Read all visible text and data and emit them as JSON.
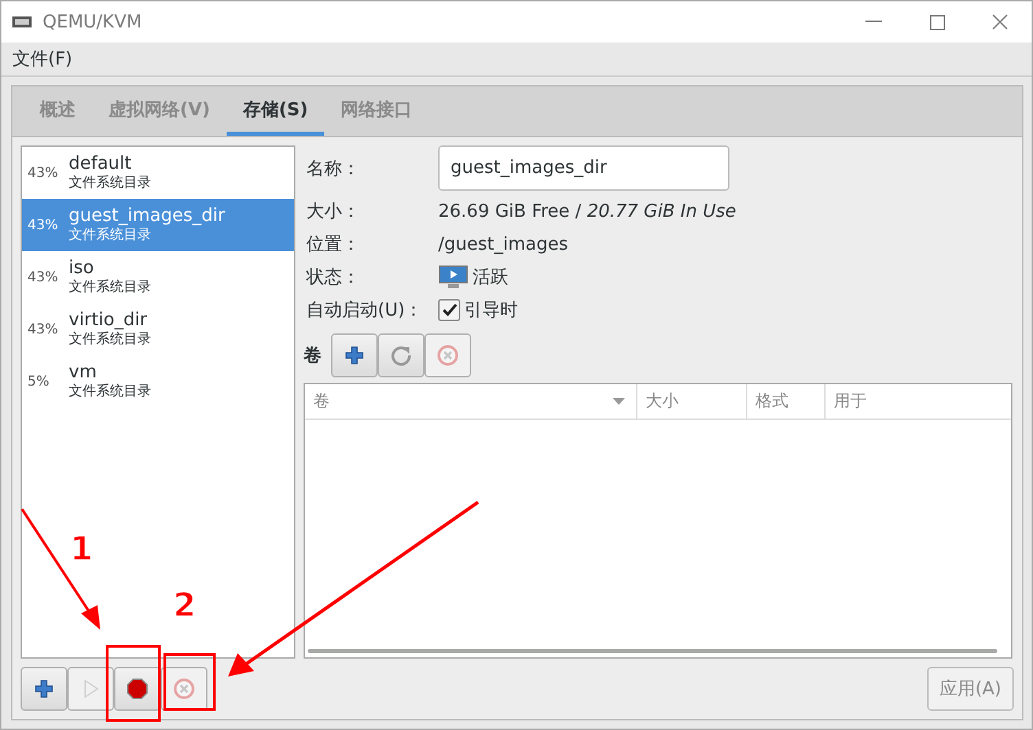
{
  "window": {
    "title": "QEMU/KVM"
  },
  "menu": [
    "文件(F)"
  ],
  "tabs": [
    {
      "label": "概述",
      "selected": false
    },
    {
      "label": "虚拟网络(V)",
      "selected": false
    },
    {
      "label": "存储(S)",
      "selected": true
    },
    {
      "label": "网络接口",
      "selected": false
    }
  ],
  "pools": [
    {
      "usage": "43%",
      "name": "default",
      "type": "文件系统目录",
      "selected": false
    },
    {
      "usage": "43%",
      "name": "guest_images_dir",
      "type": "文件系统目录",
      "selected": true
    },
    {
      "usage": "43%",
      "name": "iso",
      "type": "文件系统目录",
      "selected": false
    },
    {
      "usage": "43%",
      "name": "virtio_dir",
      "type": "文件系统目录",
      "selected": false
    },
    {
      "usage": "5%",
      "name": "vm",
      "type": "文件系统目录",
      "selected": false
    }
  ],
  "details": {
    "name": {
      "label": "名称：",
      "value": "guest_images_dir"
    },
    "size": {
      "label": "大小：",
      "value": "26.69 GiB Free / *20.77 GiB In Use*"
    },
    "location": {
      "label": "位置：",
      "value": "/guest_images"
    },
    "state": {
      "label": "状态：",
      "value": "活跃",
      "active": true
    },
    "autostart": {
      "label": "自动启动(U)：",
      "checked": true,
      "text": "引导时"
    }
  },
  "volumes": {
    "label": "卷",
    "buttons": [
      {
        "kind": "add",
        "disabled": false
      },
      {
        "kind": "refresh",
        "disabled": false
      },
      {
        "kind": "delete",
        "disabled": true
      }
    ],
    "columns": [
      "卷",
      "大小",
      "格式",
      "用于"
    ]
  },
  "pool_buttons": [
    {
      "kind": "add",
      "disabled": false
    },
    {
      "kind": "start",
      "disabled": true
    },
    {
      "kind": "stop",
      "disabled": false
    },
    {
      "kind": "delete",
      "disabled": true
    }
  ],
  "apply": {
    "label": "应用(A)",
    "disabled": true
  },
  "annotations": [
    "1",
    "2"
  ]
}
